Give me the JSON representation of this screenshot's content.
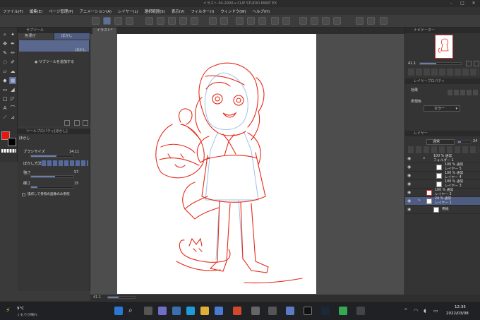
{
  "window": {
    "title": "イラスト 04-2000.v CLIP STUDIO PAINT EX"
  },
  "menu": [
    "ファイル(F)",
    "編集(E)",
    "ページ管理(P)",
    "アニメーション(A)",
    "レイヤー(L)",
    "選択範囲(S)",
    "表示(V)",
    "フィルター(I)",
    "ウィンドウ(W)",
    "ヘルプ(H)"
  ],
  "subtool": {
    "panel_title": "サブツール",
    "tab_label": "色混ぜ",
    "tab2_label": "ぼかし",
    "item_label": "ぼかし",
    "add_label": "サブツールを追加する"
  },
  "toolprop": {
    "panel_title": "ツールプロパティ[ぼかし]",
    "tool_name": "ぼかし",
    "brush_size_label": "ブラシサイズ",
    "brush_size_value": "14.11",
    "blur_width_label": "ぼかし方法",
    "strength_label": "強さ",
    "strength_value": "57",
    "hardness_label": "硬さ",
    "hardness_value": "15",
    "ref_label": "操作して参照の画像のみ参照"
  },
  "colors": {
    "main": "#e8160e",
    "sub": "#000000",
    "accent": "#4e5c82"
  },
  "canvas": {
    "tab": "イラスト*",
    "zoom": "41.1"
  },
  "navigator": {
    "title": "ナビゲーター",
    "zoom": "41.1"
  },
  "layer_property": {
    "title": "レイヤープロパティ",
    "effect_label": "効果",
    "color_label": "表現色",
    "color_value": "カラー"
  },
  "layers_panel": {
    "title": "レイヤー",
    "blend": "通常",
    "opacity": "24"
  },
  "layers": [
    {
      "mode": "100 % 通常",
      "name": "フォルダー 1",
      "type": "folder"
    },
    {
      "mode": "100 % 通常",
      "name": "レイヤー 5",
      "type": "layer"
    },
    {
      "mode": "100 % 通常",
      "name": "レイヤー 4",
      "type": "layer"
    },
    {
      "mode": "100 % 通常",
      "name": "レイヤー 3",
      "type": "layer"
    },
    {
      "mode": "100 % 通常",
      "name": "レイヤー 2",
      "type": "layer"
    },
    {
      "mode": "24 % 通常",
      "name": "レイヤー 1",
      "type": "layer",
      "selected": true
    },
    {
      "mode": "",
      "name": "用紙",
      "type": "paper"
    }
  ],
  "taskbar": {
    "weather_temp": "9°C",
    "weather_desc": "くもりが晴れ",
    "time": "12:35",
    "date": "2022/03/08"
  }
}
